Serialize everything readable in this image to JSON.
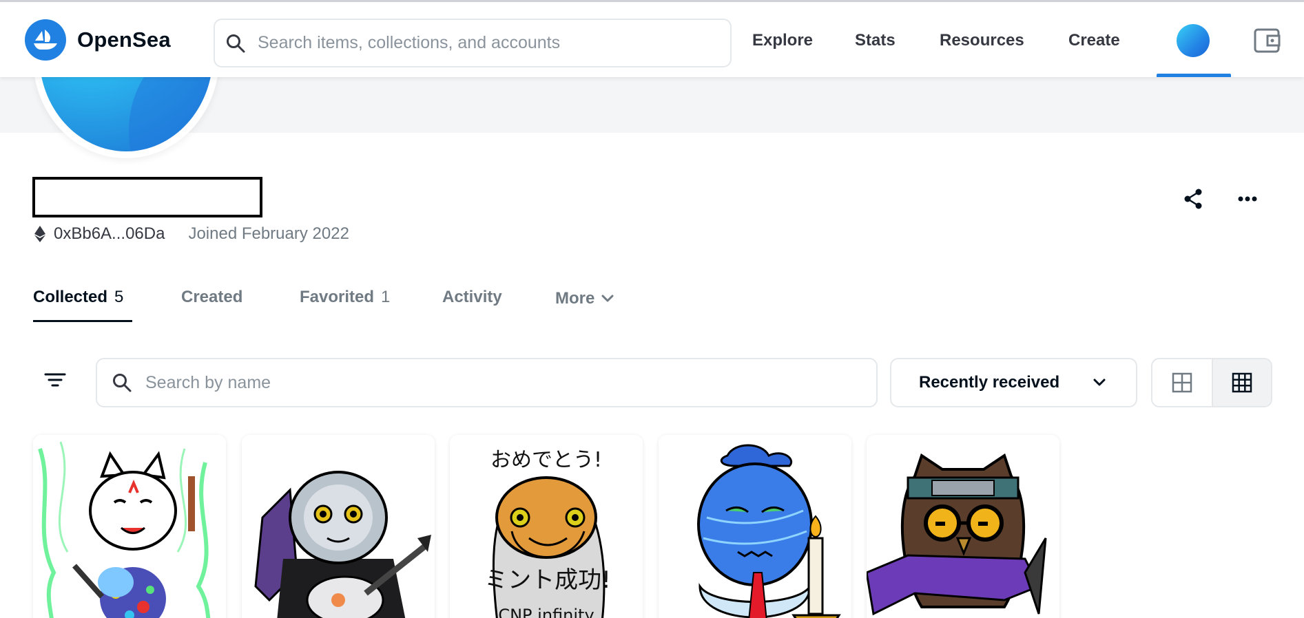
{
  "header": {
    "logo_text": "OpenSea",
    "search_placeholder": "Search items, collections, and accounts",
    "nav": {
      "explore": "Explore",
      "stats": "Stats",
      "resources": "Resources",
      "create": "Create"
    }
  },
  "profile": {
    "address": "0xBb6A...06Da",
    "joined": "Joined February 2022",
    "accent_color": "#2081e2"
  },
  "tabs": [
    {
      "label": "Collected",
      "count": "5",
      "active": true
    },
    {
      "label": "Created",
      "count": ""
    },
    {
      "label": "Favorited",
      "count": "1"
    },
    {
      "label": "Activity",
      "count": ""
    },
    {
      "label": "More",
      "count": ""
    }
  ],
  "toolbar": {
    "search_placeholder": "Search by name",
    "sort_selected": "Recently received",
    "view_options": [
      "large-grid-icon",
      "compact-grid-icon"
    ],
    "active_view": "compact-grid-icon"
  },
  "items": [
    {
      "name": "kitsune-mask-ninja",
      "caption": ""
    },
    {
      "name": "silver-snake-guitarist",
      "caption": ""
    },
    {
      "name": "orange-snake-congrats",
      "caption_top": "おめでとう!",
      "caption_bottom": "ミント成功!",
      "caption_footer": "CNP infinity"
    },
    {
      "name": "blue-ghost-candle",
      "caption": ""
    },
    {
      "name": "owl-ninja",
      "caption": ""
    }
  ]
}
